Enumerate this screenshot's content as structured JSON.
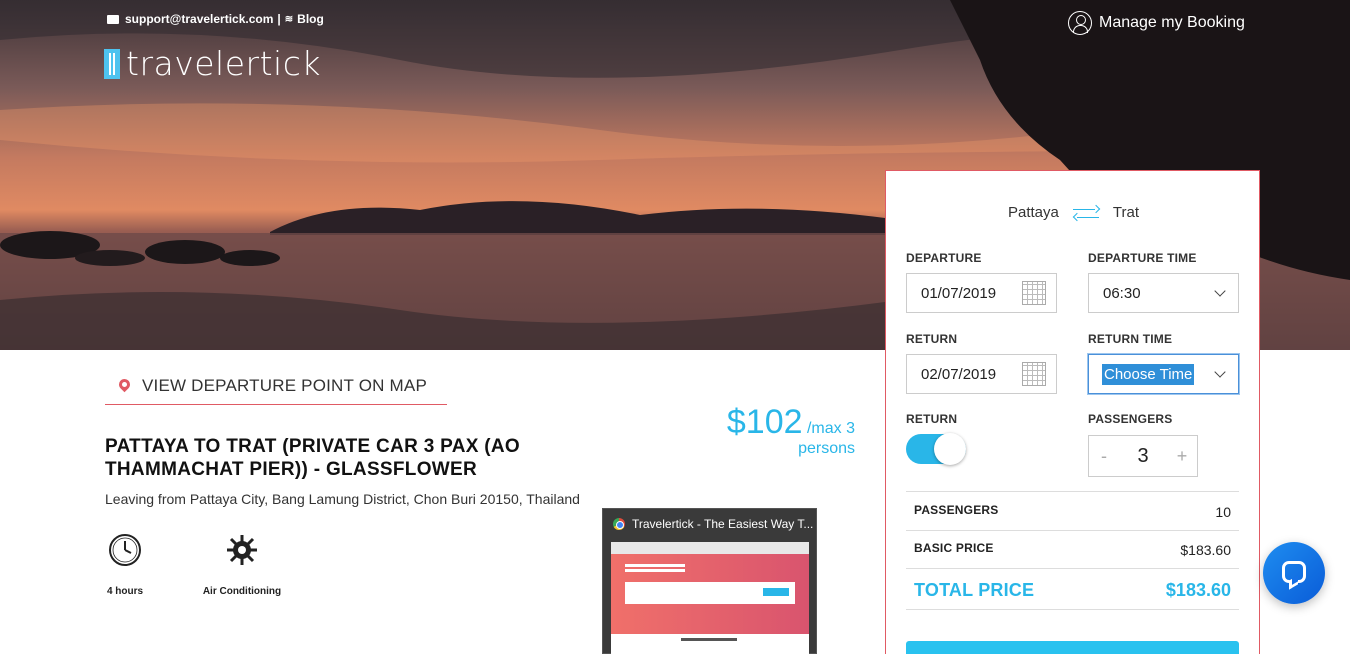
{
  "header": {
    "email": "support@travelertick.com",
    "separator": "|",
    "blog": "Blog",
    "logo_text": "travelertick",
    "manage_booking": "Manage my Booking"
  },
  "trip": {
    "map_link": "VIEW DEPARTURE POINT ON MAP",
    "title": "PATTAYA TO TRAT (PRIVATE CAR 3 PAX (AO THAMMACHAT PIER)) - GLASSFLOWER",
    "leaving_from": "Leaving from Pattaya City, Bang Lamung District, Chon Buri 20150, Thailand",
    "price": "$102",
    "price_unit": "/max 3",
    "price_unit2": "persons",
    "features": [
      {
        "icon": "clock-icon",
        "label": "4 hours"
      },
      {
        "icon": "snowflake-icon",
        "label": "Air Conditioning"
      }
    ]
  },
  "booking": {
    "from": "Pattaya",
    "to": "Trat",
    "departure_label": "DEPARTURE",
    "departure_value": "01/07/2019",
    "departure_time_label": "DEPARTURE TIME",
    "departure_time_value": "06:30",
    "return_label": "RETURN",
    "return_value": "02/07/2019",
    "return_time_label": "RETURN TIME",
    "return_time_value": "Choose Time",
    "return_toggle_label": "RETURN",
    "return_toggle_on": true,
    "passengers_label": "PASSENGERS",
    "passengers_value": "3",
    "minus": "-",
    "plus": "+",
    "summary": {
      "passengers_label": "PASSENGERS",
      "passengers_value": "10",
      "basic_price_label": "BASIC PRICE",
      "basic_price_value": "$183.60",
      "total_label": "TOTAL PRICE",
      "total_value": "$183.60"
    }
  },
  "tab_preview": {
    "title": "Travelertick - The Easiest Way T..."
  },
  "colors": {
    "accent": "#29b6e8",
    "pin": "#e05a64",
    "chat": "#1570e6"
  }
}
